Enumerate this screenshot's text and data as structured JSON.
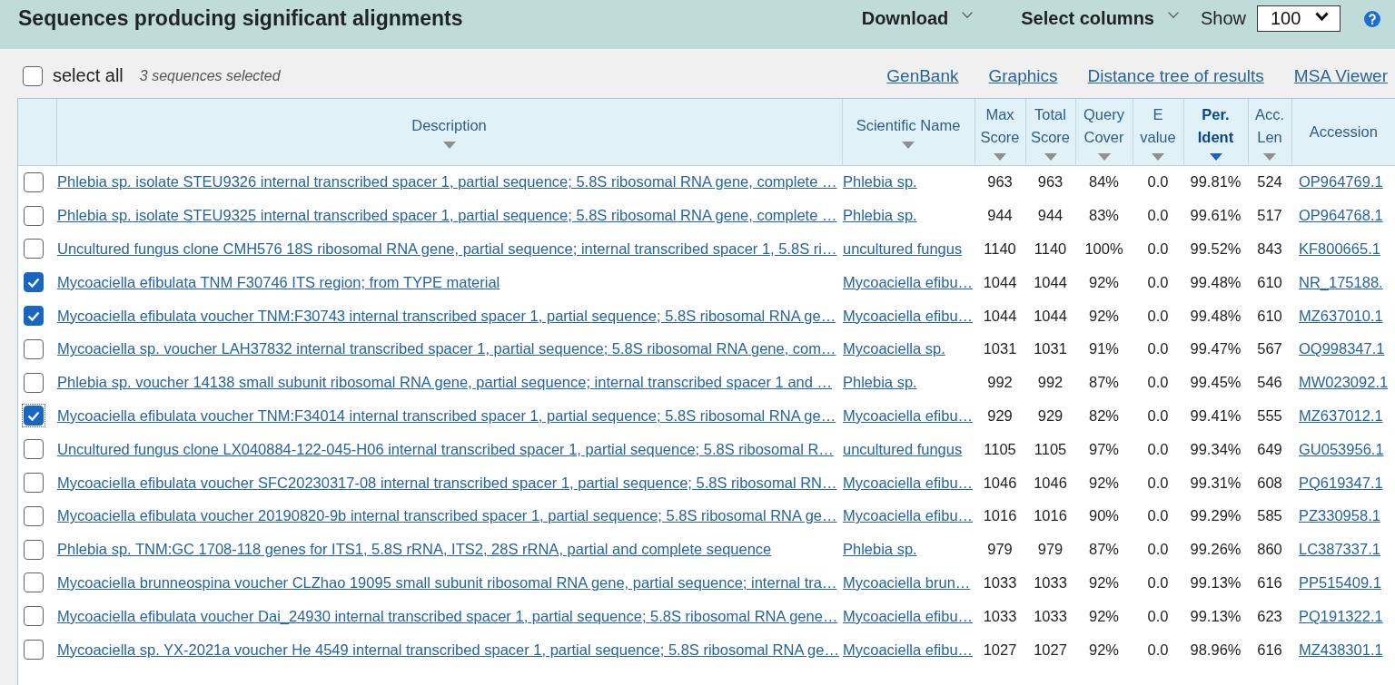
{
  "header": {
    "title": "Sequences producing significant alignments",
    "menus": [
      "Download",
      "Select columns"
    ],
    "show": {
      "label": "Show",
      "value": "100"
    }
  },
  "toolbar": {
    "select_all": {
      "label": "select all",
      "checked": false
    },
    "selection_count": "3 sequences selected",
    "links": [
      "GenBank",
      "Graphics",
      "Distance tree of results",
      "MSA Viewer"
    ]
  },
  "table": {
    "columns": [
      {
        "lines": [
          "Description"
        ],
        "kind": "description",
        "sortable": true,
        "sorted": false
      },
      {
        "lines": [
          "Scientific Name"
        ],
        "kind": "taxon",
        "sortable": true,
        "sorted": false
      },
      {
        "lines": [
          "Max",
          "Score"
        ],
        "kind": "number",
        "sortable": true,
        "sorted": false
      },
      {
        "lines": [
          "Total",
          "Score"
        ],
        "kind": "number",
        "sortable": true,
        "sorted": false
      },
      {
        "lines": [
          "Query",
          "Cover"
        ],
        "kind": "number",
        "sortable": true,
        "sorted": false
      },
      {
        "lines": [
          "E",
          "value"
        ],
        "kind": "number",
        "sortable": true,
        "sorted": false
      },
      {
        "lines": [
          "Per.",
          "Ident"
        ],
        "kind": "number",
        "sortable": true,
        "sorted": true
      },
      {
        "lines": [
          "Acc.",
          "Len"
        ],
        "kind": "number",
        "sortable": true,
        "sorted": false
      },
      {
        "lines": [
          "Accession"
        ],
        "kind": "accession",
        "sortable": false,
        "sorted": false
      }
    ],
    "rows": [
      {
        "checked": false,
        "focused": false,
        "cells": [
          "Phlebia sp. isolate STEU9326 internal transcribed spacer 1, partial sequence; 5.8S ribosomal RNA gene, complete …",
          "Phlebia sp.",
          "963",
          "963",
          "84%",
          "0.0",
          "99.81%",
          "524",
          "OP964769.1"
        ]
      },
      {
        "checked": false,
        "focused": false,
        "cells": [
          "Phlebia sp. isolate STEU9325 internal transcribed spacer 1, partial sequence; 5.8S ribosomal RNA gene, complete …",
          "Phlebia sp.",
          "944",
          "944",
          "83%",
          "0.0",
          "99.61%",
          "517",
          "OP964768.1"
        ]
      },
      {
        "checked": false,
        "focused": false,
        "cells": [
          "Uncultured fungus clone CMH576 18S ribosomal RNA gene, partial sequence; internal transcribed spacer 1, 5.8S ri…",
          "uncultured fungus",
          "1140",
          "1140",
          "100%",
          "0.0",
          "99.52%",
          "843",
          "KF800665.1"
        ]
      },
      {
        "checked": true,
        "focused": false,
        "cells": [
          "Mycoaciella efibulata TNM F30746 ITS region; from TYPE material",
          "Mycoaciella efibu…",
          "1044",
          "1044",
          "92%",
          "0.0",
          "99.48%",
          "610",
          "NR_175188."
        ]
      },
      {
        "checked": true,
        "focused": false,
        "cells": [
          "Mycoaciella efibulata voucher TNM:F30743 internal transcribed spacer 1, partial sequence; 5.8S ribosomal RNA ge…",
          "Mycoaciella efibu…",
          "1044",
          "1044",
          "92%",
          "0.0",
          "99.48%",
          "610",
          "MZ637010.1"
        ]
      },
      {
        "checked": false,
        "focused": false,
        "cells": [
          "Mycoaciella sp. voucher LAH37832 internal transcribed spacer 1, partial sequence; 5.8S ribosomal RNA gene, com…",
          "Mycoaciella sp.",
          "1031",
          "1031",
          "91%",
          "0.0",
          "99.47%",
          "567",
          "OQ998347.1"
        ]
      },
      {
        "checked": false,
        "focused": false,
        "cells": [
          "Phlebia sp. voucher 14138 small subunit ribosomal RNA gene, partial sequence; internal transcribed spacer 1 and …",
          "Phlebia sp.",
          "992",
          "992",
          "87%",
          "0.0",
          "99.45%",
          "546",
          "MW023092.1"
        ]
      },
      {
        "checked": true,
        "focused": true,
        "cells": [
          "Mycoaciella efibulata voucher TNM:F34014 internal transcribed spacer 1, partial sequence; 5.8S ribosomal RNA ge…",
          "Mycoaciella efibu…",
          "929",
          "929",
          "82%",
          "0.0",
          "99.41%",
          "555",
          "MZ637012.1"
        ]
      },
      {
        "checked": false,
        "focused": false,
        "cells": [
          "Uncultured fungus clone LX040884-122-045-H06 internal transcribed spacer 1, partial sequence; 5.8S ribosomal R…",
          "uncultured fungus",
          "1105",
          "1105",
          "97%",
          "0.0",
          "99.34%",
          "649",
          "GU053956.1"
        ]
      },
      {
        "checked": false,
        "focused": false,
        "cells": [
          "Mycoaciella efibulata voucher SFC20230317-08 internal transcribed spacer 1, partial sequence; 5.8S ribosomal RN…",
          "Mycoaciella efibu…",
          "1046",
          "1046",
          "92%",
          "0.0",
          "99.31%",
          "608",
          "PQ619347.1"
        ]
      },
      {
        "checked": false,
        "focused": false,
        "cells": [
          "Mycoaciella efibulata voucher 20190820-9b internal transcribed spacer 1, partial sequence; 5.8S ribosomal RNA ge…",
          "Mycoaciella efibu…",
          "1016",
          "1016",
          "90%",
          "0.0",
          "99.29%",
          "585",
          "PZ330958.1"
        ]
      },
      {
        "checked": false,
        "focused": false,
        "cells": [
          "Phlebia sp. TNM:GC 1708-118 genes for ITS1, 5.8S rRNA, ITS2, 28S rRNA, partial and complete sequence",
          "Phlebia sp.",
          "979",
          "979",
          "87%",
          "0.0",
          "99.26%",
          "860",
          "LC387337.1"
        ]
      },
      {
        "checked": false,
        "focused": false,
        "cells": [
          "Mycoaciella brunneospina voucher CLZhao 19095 small subunit ribosomal RNA gene, partial sequence; internal tra…",
          "Mycoaciella brun…",
          "1033",
          "1033",
          "92%",
          "0.0",
          "99.13%",
          "616",
          "PP515409.1"
        ]
      },
      {
        "checked": false,
        "focused": false,
        "cells": [
          "Mycoaciella efibulata voucher Dai_24930 internal transcribed spacer 1, partial sequence; 5.8S ribosomal RNA gene…",
          "Mycoaciella efibu…",
          "1033",
          "1033",
          "92%",
          "0.0",
          "99.13%",
          "623",
          "PQ191322.1"
        ]
      },
      {
        "checked": false,
        "focused": false,
        "cells": [
          "Mycoaciella sp. YX-2021a voucher He 4549 internal transcribed spacer 1, partial sequence; 5.8S ribosomal RNA ge…",
          "Mycoaciella efibu…",
          "1027",
          "1027",
          "92%",
          "0.0",
          "98.96%",
          "616",
          "MZ438301.1"
        ]
      }
    ]
  }
}
